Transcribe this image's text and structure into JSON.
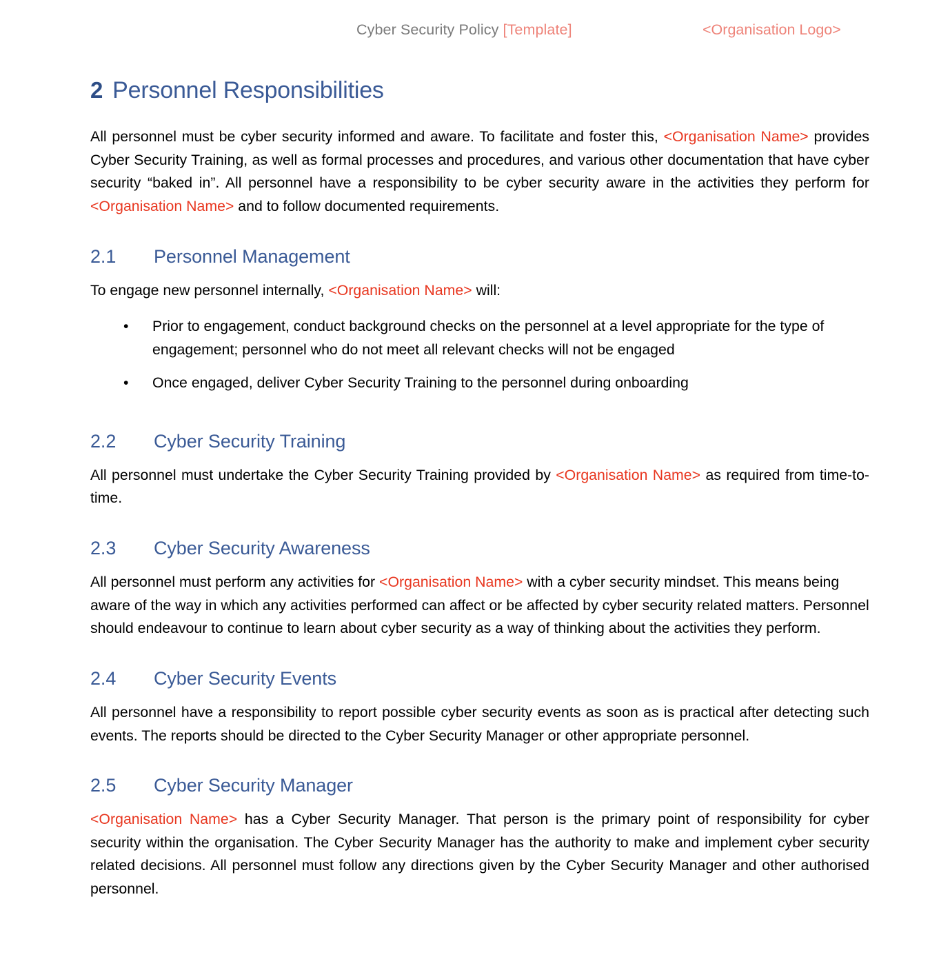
{
  "header": {
    "title_main": "Cyber Security Policy ",
    "title_template": "[Template]",
    "logo_placeholder": "<Organisation Logo>"
  },
  "colors": {
    "heading_blue": "#3a5a96",
    "heading_number_blue": "#2e4e87",
    "placeholder_red": "#e8361f",
    "header_gray": "#7a7a7a",
    "header_salmon": "#ee8379",
    "body_black": "#000000",
    "page_background": "#ffffff"
  },
  "chapter": {
    "number": "2",
    "title": "Personnel Responsibilities"
  },
  "intro": {
    "part1": "All personnel must be cyber security informed and aware. To facilitate and foster this, ",
    "ph1": "<Organisation Name>",
    "part2": " provides Cyber Security Training, as well as formal processes and procedures, and various other documentation that have cyber security “baked in”. All personnel have a responsibility to be cyber security aware in the activities they perform for ",
    "ph2": "<Organisation Name>",
    "part3": " and to follow documented requirements."
  },
  "sections": [
    {
      "number": "2.1",
      "title": "Personnel Management",
      "lead": {
        "part1": "To engage new personnel internally, ",
        "ph1": "<Organisation Name>",
        "part2": " will:"
      },
      "bullet_marker": "•",
      "bullets": [
        "Prior to engagement, conduct background checks on the personnel at a level appropriate for the type of engagement; personnel who do not meet all relevant checks will not be engaged",
        "Once engaged, deliver Cyber Security Training to the personnel during onboarding"
      ]
    },
    {
      "number": "2.2",
      "title": "Cyber Security Training",
      "body": {
        "part1": "All personnel must undertake the Cyber Security Training provided by ",
        "ph1": "<Organisation Name>",
        "part2": " as required from time-to-time."
      }
    },
    {
      "number": "2.3",
      "title": "Cyber Security Awareness",
      "body": {
        "part1": "All personnel must perform any activities for ",
        "ph1": "<Organisation Name>",
        "part2": " with a cyber security mindset. This means being aware of the way in which any activities performed can affect or be affected by cyber security related matters. Personnel should endeavour to continue to learn about cyber security as a way of thinking about the activities they perform."
      }
    },
    {
      "number": "2.4",
      "title": "Cyber Security Events",
      "body": {
        "part1": "All personnel have a responsibility to report possible cyber security events as soon as is practical after detecting such events. The reports should be directed to the Cyber Security Manager or other appropriate personnel."
      }
    },
    {
      "number": "2.5",
      "title": "Cyber Security Manager",
      "body": {
        "ph1": "<Organisation Name>",
        "part2": " has a Cyber Security Manager. That person is the primary point of responsibility for cyber security within the organisation. The Cyber Security Manager has the authority to make and implement cyber security related decisions. All personnel must follow any directions given by the Cyber Security Manager and other authorised personnel."
      }
    }
  ]
}
